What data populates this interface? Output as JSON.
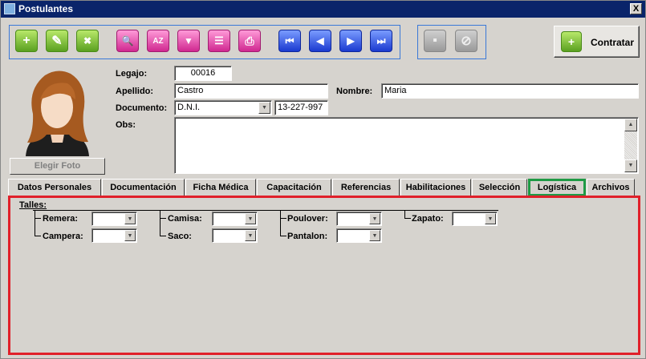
{
  "window": {
    "title": "Postulantes",
    "close_label": "X"
  },
  "toolbar": {
    "buttons": [
      {
        "name": "add-button",
        "icon": "plus-icon",
        "glyph": "+"
      },
      {
        "name": "edit-button",
        "icon": "pencil-icon",
        "glyph": "✎"
      },
      {
        "name": "delete-button",
        "icon": "delete-doc-icon",
        "glyph": "✖"
      },
      {
        "name": "search-button",
        "icon": "magnifier-icon",
        "glyph": "🔍"
      },
      {
        "name": "sort-button",
        "icon": "sort-az-icon",
        "glyph": "AZ"
      },
      {
        "name": "filter-button",
        "icon": "funnel-icon",
        "glyph": "▼"
      },
      {
        "name": "report-button",
        "icon": "clipboard-icon",
        "glyph": "☰"
      },
      {
        "name": "print-button",
        "icon": "printer-icon",
        "glyph": "⎙"
      },
      {
        "name": "first-record-button",
        "icon": "first-icon",
        "glyph": "⏮"
      },
      {
        "name": "prev-record-button",
        "icon": "prev-icon",
        "glyph": "◀"
      },
      {
        "name": "next-record-button",
        "icon": "next-icon",
        "glyph": "▶"
      },
      {
        "name": "last-record-button",
        "icon": "last-icon",
        "glyph": "⏭"
      },
      {
        "name": "save-button",
        "icon": "save-icon",
        "glyph": "▪"
      },
      {
        "name": "cancel-button",
        "icon": "cancel-icon",
        "glyph": "⊘"
      }
    ],
    "contratar_label": "Contratar"
  },
  "photo": {
    "button_label": "Elegir Foto"
  },
  "form": {
    "legajo_label": "Legajo:",
    "legajo_value": "00016",
    "apellido_label": "Apellido:",
    "apellido_value": "Castro",
    "nombre_label": "Nombre:",
    "nombre_value": "Maria",
    "documento_label": "Documento:",
    "documento_tipo": "D.N.I.",
    "documento_numero": "13-227-997",
    "obs_label": "Obs:",
    "obs_value": ""
  },
  "tabs": [
    {
      "label": "Datos Personales"
    },
    {
      "label": "Documentación"
    },
    {
      "label": "Ficha Médica"
    },
    {
      "label": "Capacitación"
    },
    {
      "label": "Referencias"
    },
    {
      "label": "Habilitaciones"
    },
    {
      "label": "Selección"
    },
    {
      "label": "Logística",
      "active": true
    },
    {
      "label": "Archivos"
    }
  ],
  "logistica": {
    "talles_label": "Talles:",
    "fields": [
      {
        "label": "Remera:",
        "value": ""
      },
      {
        "label": "Campera:",
        "value": ""
      },
      {
        "label": "Camisa:",
        "value": ""
      },
      {
        "label": "Saco:",
        "value": ""
      },
      {
        "label": "Poulover:",
        "value": ""
      },
      {
        "label": "Pantalon:",
        "value": ""
      },
      {
        "label": "Zapato:",
        "value": ""
      }
    ]
  },
  "colors": {
    "title_bar": "#0a246a",
    "active_tab_border": "#1f9a45",
    "panel_highlight": "#e0202a",
    "toolbar_group_border": "#3a78d8"
  }
}
